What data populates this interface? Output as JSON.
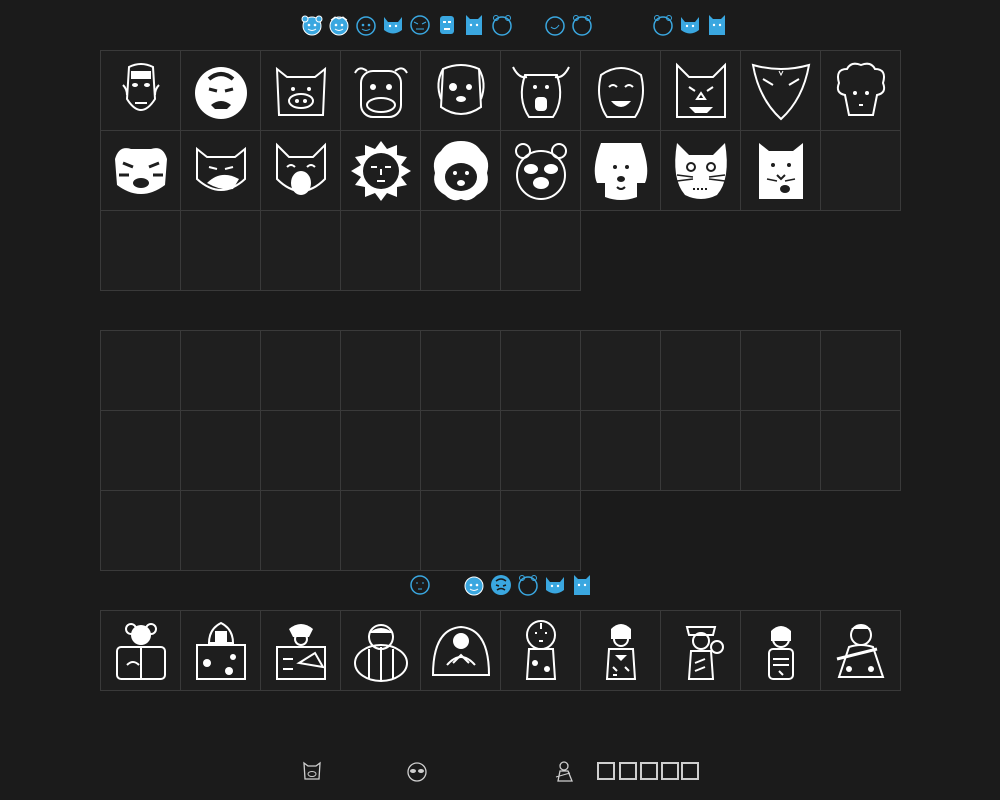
{
  "app": {
    "accent_color": "#3aa7e0",
    "outline_color": "#ffffff"
  },
  "top_strip": {
    "glyphs": [
      "bear-head",
      "lion-head",
      "tiger-head",
      "cat-head",
      "tiger-face",
      "robot-face",
      "cat-square",
      "tiger-outline",
      "fox-face",
      "tiger-outline",
      "tiger-outline",
      "cat-head",
      "cat-square"
    ]
  },
  "grid_masks": {
    "rows": [
      [
        "tengu-mask",
        "oni-mask",
        "boar-mask",
        "ox-mask",
        "dog-mask",
        "cow-mask",
        "okame-mask",
        "cat-mask",
        "fox-mask",
        "sheep-mask"
      ],
      [
        "tiger-mask",
        "pig-mask",
        "cat-happy-mask",
        "sun-mask",
        "lion-mask",
        "tanuki-mask",
        "dog-floppy-mask",
        "cat-white-mask",
        "cat-square-mask",
        ""
      ],
      [
        "",
        "",
        "",
        "",
        "",
        "",
        "",
        "",
        "",
        ""
      ]
    ]
  },
  "grid_empty": {
    "rows": 3
  },
  "middle_strip": {
    "glyphs": [
      "moon-face",
      "lion-head",
      "oni-head",
      "tiger-outline",
      "cat-head",
      "cat-square"
    ]
  },
  "grid_dolls": {
    "items": [
      "kokeshi-flower",
      "kokeshi-robe",
      "kokeshi-fan",
      "kokeshi-round",
      "kokeshi-dome",
      "kokeshi-daruma",
      "kokeshi-girl",
      "kokeshi-geisha",
      "kokeshi-slim",
      "kokeshi-flute"
    ]
  },
  "bottom_strip": {
    "glyphs": [
      "boar-small",
      "tanuki-small",
      "doll-small"
    ],
    "missing_glyph_count": 5
  }
}
